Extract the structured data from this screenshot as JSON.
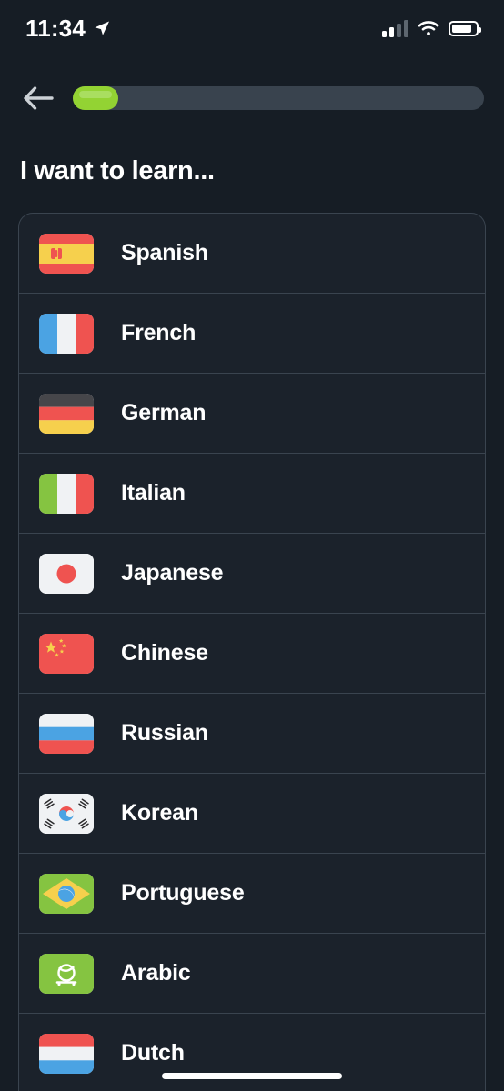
{
  "status_bar": {
    "time": "11:34",
    "location_icon": "location-arrow-icon",
    "signal_icon": "cellular-signal-icon",
    "signal_bars_filled": 2,
    "signal_bars_total": 4,
    "wifi_icon": "wifi-icon",
    "battery_icon": "battery-icon",
    "battery_level_percent": 82
  },
  "header": {
    "back_icon": "back-arrow-icon",
    "progress_percent": 11,
    "progress_fill_color": "#93d333",
    "progress_track_color": "#39434e"
  },
  "title": "I want to learn...",
  "colors": {
    "page_background": "#161d25",
    "card_background": "#1b222b",
    "border": "#3a444f",
    "text": "#ffffff",
    "accent_green": "#93d333"
  },
  "languages": [
    {
      "label": "Spanish",
      "flag": "flag-spain",
      "flag_name": "spain-flag-icon"
    },
    {
      "label": "French",
      "flag": "flag-france",
      "flag_name": "france-flag-icon"
    },
    {
      "label": "German",
      "flag": "flag-germany",
      "flag_name": "germany-flag-icon"
    },
    {
      "label": "Italian",
      "flag": "flag-italy",
      "flag_name": "italy-flag-icon"
    },
    {
      "label": "Japanese",
      "flag": "flag-japan",
      "flag_name": "japan-flag-icon"
    },
    {
      "label": "Chinese",
      "flag": "flag-china",
      "flag_name": "china-flag-icon"
    },
    {
      "label": "Russian",
      "flag": "flag-russia",
      "flag_name": "russia-flag-icon"
    },
    {
      "label": "Korean",
      "flag": "flag-south-korea",
      "flag_name": "south-korea-flag-icon"
    },
    {
      "label": "Portuguese",
      "flag": "flag-brazil",
      "flag_name": "brazil-flag-icon"
    },
    {
      "label": "Arabic",
      "flag": "flag-saudi-arabia",
      "flag_name": "saudi-arabia-flag-icon"
    },
    {
      "label": "Dutch",
      "flag": "flag-netherlands",
      "flag_name": "netherlands-flag-icon"
    }
  ]
}
